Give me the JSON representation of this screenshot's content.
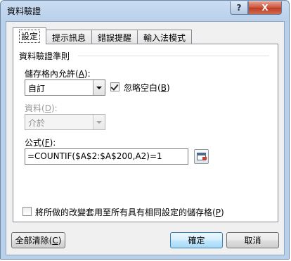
{
  "window": {
    "title": "資料驗證",
    "help_label": "?",
    "close_label": "X"
  },
  "tabs": [
    {
      "label": "設定"
    },
    {
      "label": "提示訊息"
    },
    {
      "label": "錯誤提醒"
    },
    {
      "label": "輸入法模式"
    }
  ],
  "criteria": {
    "group_title": "資料驗證準則",
    "allow_label": "儲存格內允許",
    "allow_key": "A",
    "allow_value": "自訂",
    "ignore_blank_label": "忽略空白",
    "ignore_blank_key": "B",
    "ignore_blank_checked": true,
    "data_label": "資料",
    "data_key": "D",
    "data_value": "介於",
    "formula_label": "公式",
    "formula_key": "F",
    "formula_value": "=COUNTIF($A$2:$A$200,A2)=1"
  },
  "apply_all": {
    "label": "將所做的改變套用至所有具有相同設定的儲存格",
    "key": "P",
    "checked": false
  },
  "footer": {
    "clear_all_label": "全部清除",
    "clear_all_key": "C",
    "ok_label": "確定",
    "cancel_label": "取消"
  }
}
